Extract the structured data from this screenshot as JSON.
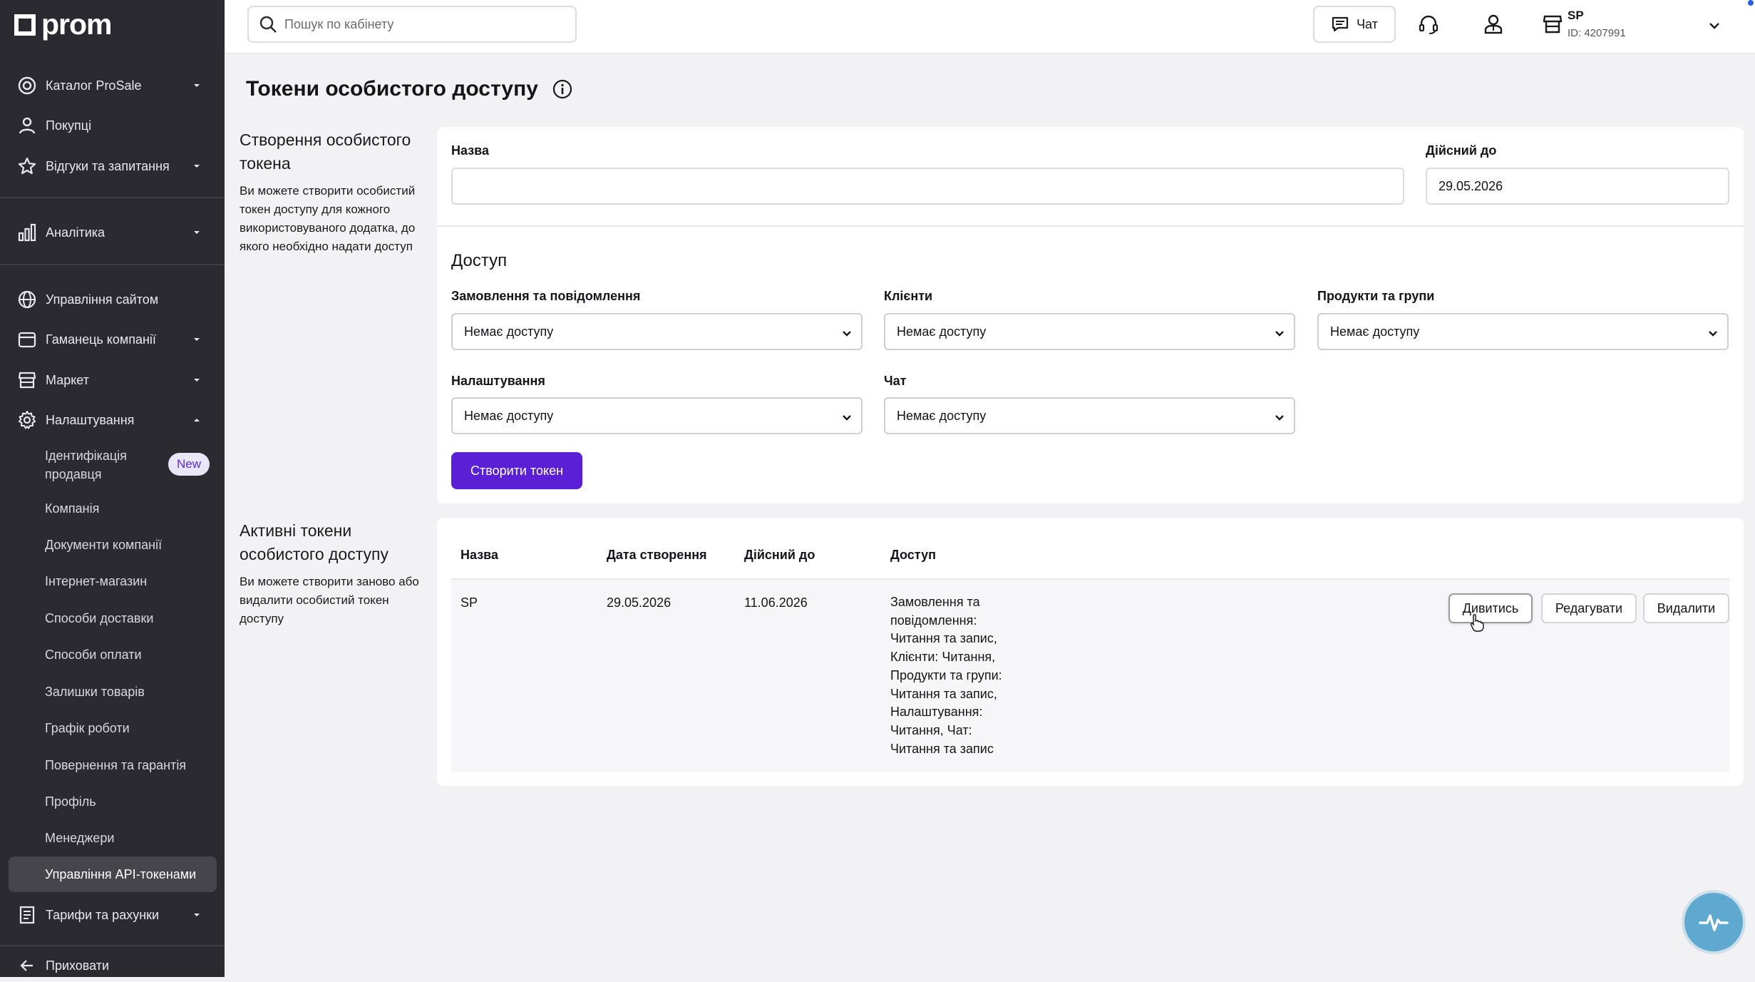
{
  "brand": {
    "logo_text": "prom"
  },
  "sidebar": {
    "items": [
      {
        "label": "Каталог ProSale",
        "icon": "target-icon",
        "has_caret": true
      },
      {
        "label": "Покупці",
        "icon": "person-icon",
        "has_caret": false
      },
      {
        "label": "Відгуки та запитання",
        "icon": "star-icon",
        "has_caret": true
      },
      {
        "label": "Аналітика",
        "icon": "bar-chart-icon",
        "has_caret": true
      },
      {
        "label": "Управління сайтом",
        "icon": "globe-icon",
        "has_caret": false
      },
      {
        "label": "Гаманець компанії",
        "icon": "wallet-icon",
        "has_caret": true
      },
      {
        "label": "Маркет",
        "icon": "store-icon",
        "has_caret": true
      },
      {
        "label": "Налаштування",
        "icon": "gear-icon",
        "has_caret": true,
        "expanded": true
      }
    ],
    "settings_sub": [
      {
        "label": "Ідентифікація продавця",
        "badge": "New"
      },
      {
        "label": "Компанія"
      },
      {
        "label": "Документи компанії"
      },
      {
        "label": "Інтернет-магазин"
      },
      {
        "label": "Способи доставки"
      },
      {
        "label": "Способи оплати"
      },
      {
        "label": "Залишки товарів"
      },
      {
        "label": "Графік роботи"
      },
      {
        "label": "Повернення та гарантія"
      },
      {
        "label": "Профіль"
      },
      {
        "label": "Менеджери"
      },
      {
        "label": "Управління API-токенами",
        "active": true
      }
    ],
    "billing": {
      "label": "Тарифи та рахунки",
      "icon": "receipt-icon"
    },
    "hide": {
      "label": "Приховати",
      "icon": "arrow-left-icon"
    }
  },
  "topbar": {
    "search_placeholder": "Пошук по кабінету",
    "chat_label": "Чат",
    "user_name": "SP",
    "user_id": "ID: 4207991"
  },
  "page": {
    "title": "Токени особистого доступу",
    "create_section": {
      "heading": "Створення особистого токена",
      "description": "Ви можете створити особистий токен доступу для кожного використовуваного додатка, до якого необхідно надати доступ"
    },
    "form": {
      "name_label": "Назва",
      "name_value": "",
      "valid_until_label": "Дійсний до",
      "valid_until_value": "29.05.2026",
      "access_title": "Доступ",
      "selects": [
        {
          "label": "Замовлення та повідомлення",
          "value": "Немає доступу"
        },
        {
          "label": "Клієнти",
          "value": "Немає доступу"
        },
        {
          "label": "Продукти та групи",
          "value": "Немає доступу"
        },
        {
          "label": "Налаштування",
          "value": "Немає доступу"
        },
        {
          "label": "Чат",
          "value": "Немає доступу"
        }
      ],
      "create_button": "Створити токен"
    },
    "active_section": {
      "heading": "Активні токени особистого доступу",
      "description": "Ви можете створити заново або видалити особистий токен доступу"
    },
    "table": {
      "columns": [
        "Назва",
        "Дата створення",
        "Дійсний до",
        "Доступ"
      ],
      "rows": [
        {
          "name": "SP",
          "created": "29.05.2026",
          "valid_until": "11.06.2026",
          "access_lines": [
            "Замовлення та",
            "повідомлення:",
            "Читання та запис,",
            "Клієнти: Читання,",
            "Продукти та групи:",
            "Читання та запис,",
            "Налаштування:",
            "Читання, Чат:",
            "Читання та запис"
          ],
          "actions": {
            "view": "Дивитись",
            "edit": "Редагувати",
            "delete": "Видалити"
          }
        }
      ]
    }
  },
  "colors": {
    "sidebar_bg": "#2b2a30",
    "primary": "#5b1fd6",
    "badge_bg": "#e9e6f8",
    "fab": "#5fa8cf"
  }
}
